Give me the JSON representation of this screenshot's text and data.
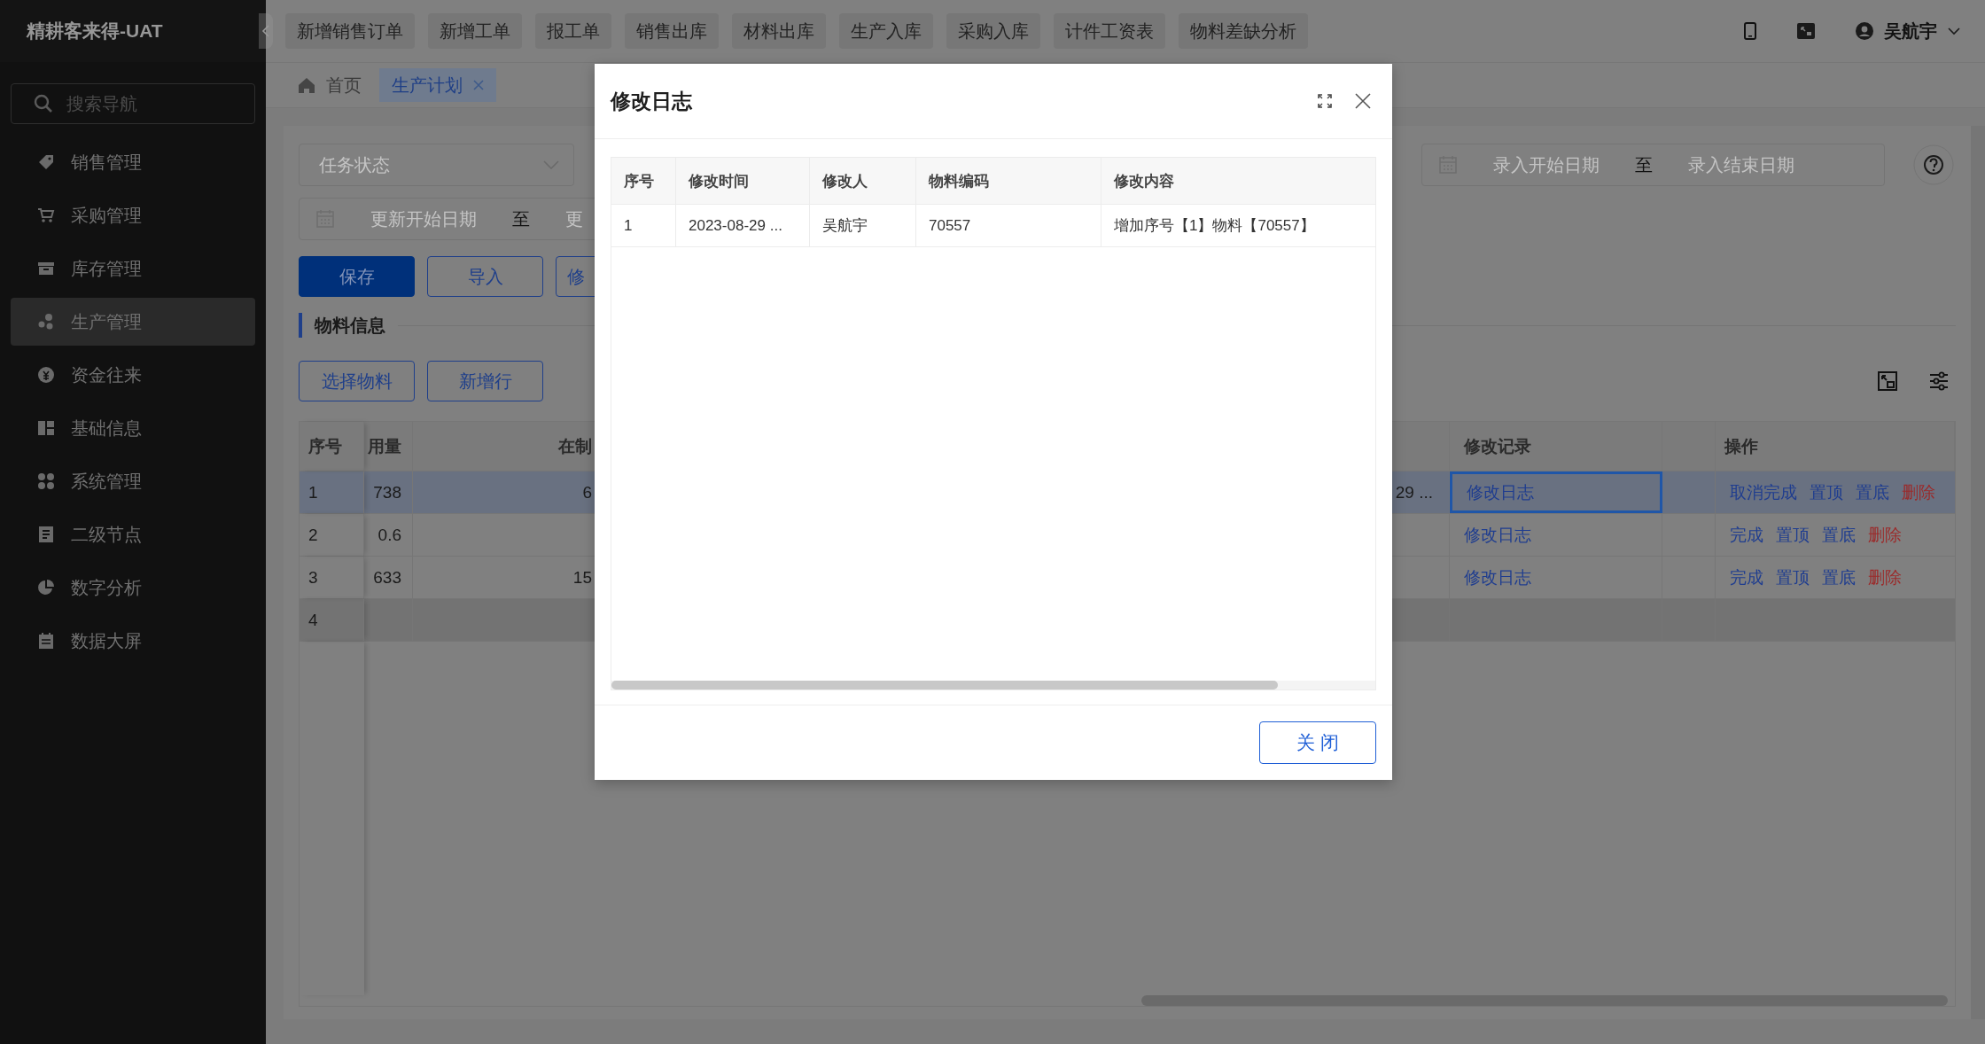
{
  "sidebar": {
    "logo": "精耕客来得-UAT",
    "search": {
      "placeholder": "搜索导航"
    },
    "items": [
      {
        "label": "销售管理",
        "selected": false
      },
      {
        "label": "采购管理",
        "selected": false
      },
      {
        "label": "库存管理",
        "selected": false
      },
      {
        "label": "生产管理",
        "selected": true
      },
      {
        "label": "资金往来",
        "selected": false
      },
      {
        "label": "基础信息",
        "selected": false
      },
      {
        "label": "系统管理",
        "selected": false
      },
      {
        "label": "二级节点",
        "selected": false
      },
      {
        "label": "数字分析",
        "selected": false
      },
      {
        "label": "数据大屏",
        "selected": false
      }
    ]
  },
  "quick_actions": [
    "新增销售订单",
    "新增工单",
    "报工单",
    "销售出库",
    "材料出库",
    "生产入库",
    "采购入库",
    "计件工资表",
    "物料差缺分析"
  ],
  "user": {
    "name": "吴航宇"
  },
  "page_tabs": [
    {
      "label": "首页",
      "selected": false,
      "closable": false
    },
    {
      "label": "生产计划",
      "selected": true,
      "closable": true
    }
  ],
  "filters": {
    "status_select": {
      "placeholder": "任务状态"
    },
    "update_range": {
      "start_placeholder": "更新开始日期",
      "separator": "至",
      "end_placeholder": "更"
    },
    "entry_range": {
      "start_placeholder": "录入开始日期",
      "separator": "至",
      "end_placeholder": "录入结束日期"
    }
  },
  "actions": [
    {
      "label": "保存",
      "kind": "primary"
    },
    {
      "label": "导入",
      "kind": "default"
    },
    {
      "label": "修",
      "kind": "default"
    }
  ],
  "section_title": "物料信息",
  "material_actions": [
    "选择物料",
    "新增行"
  ],
  "table": {
    "columns": [
      "序号",
      "用量",
      "在制",
      "修改记录",
      "操作"
    ],
    "rows": [
      {
        "index": "1",
        "usage": "738",
        "in_process": "6",
        "date": "29 ...",
        "log": "修改日志",
        "log_focused": true,
        "selected": true,
        "hovered": false,
        "operations": [
          {
            "label": "取消完成",
            "kind": "link"
          },
          {
            "label": "置顶",
            "kind": "link"
          },
          {
            "label": "置底",
            "kind": "link"
          },
          {
            "label": "删除",
            "kind": "danger"
          }
        ]
      },
      {
        "index": "2",
        "usage": "0.6",
        "log": "修改日志",
        "log_focused": false,
        "selected": false,
        "hovered": false,
        "operations": [
          {
            "label": "完成",
            "kind": "link"
          },
          {
            "label": "置顶",
            "kind": "link"
          },
          {
            "label": "置底",
            "kind": "link"
          },
          {
            "label": "删除",
            "kind": "danger"
          }
        ]
      },
      {
        "index": "3",
        "usage": "633",
        "in_process": "15",
        "log": "修改日志",
        "log_focused": false,
        "selected": false,
        "hovered": false,
        "operations": [
          {
            "label": "完成",
            "kind": "link"
          },
          {
            "label": "置顶",
            "kind": "link"
          },
          {
            "label": "置底",
            "kind": "link"
          },
          {
            "label": "删除",
            "kind": "danger"
          }
        ]
      },
      {
        "index": "4",
        "log_focused": false,
        "selected": false,
        "hovered": true
      }
    ]
  },
  "modal": {
    "title": "修改日志",
    "columns": [
      "序号",
      "修改时间",
      "修改人",
      "物料编码",
      "修改内容"
    ],
    "rows": [
      [
        "1",
        "2023-08-29 ...",
        "吴航宇",
        "70557",
        "增加序号【1】物料【70557】"
      ]
    ],
    "buttons": [
      "关 闭"
    ]
  }
}
